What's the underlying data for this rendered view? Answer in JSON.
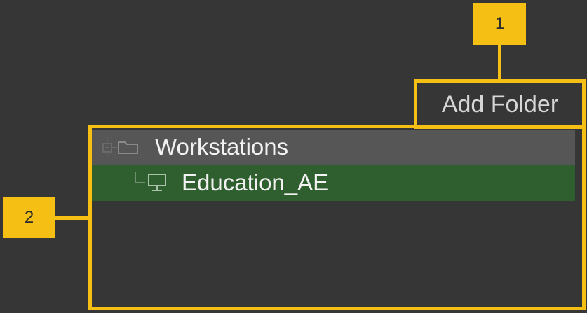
{
  "callouts": {
    "badge_1": "1",
    "badge_2": "2"
  },
  "toolbar": {
    "add_folder_label": "Add Folder"
  },
  "tree": {
    "items": [
      {
        "label": "Workstations",
        "icon": "folder-icon",
        "expander": "tree-collapse-icon",
        "selected": false
      },
      {
        "label": "Education_AE",
        "icon": "computer-icon",
        "connector": "tree-branch-line-icon",
        "selected": true
      }
    ]
  },
  "colors": {
    "background": "#363636",
    "callout": "#f6bf13",
    "folder_row": "#565656",
    "selected_row": "#2f5f2f",
    "text": "#f2f2f2",
    "add_folder_text": "#d6d6d6"
  }
}
